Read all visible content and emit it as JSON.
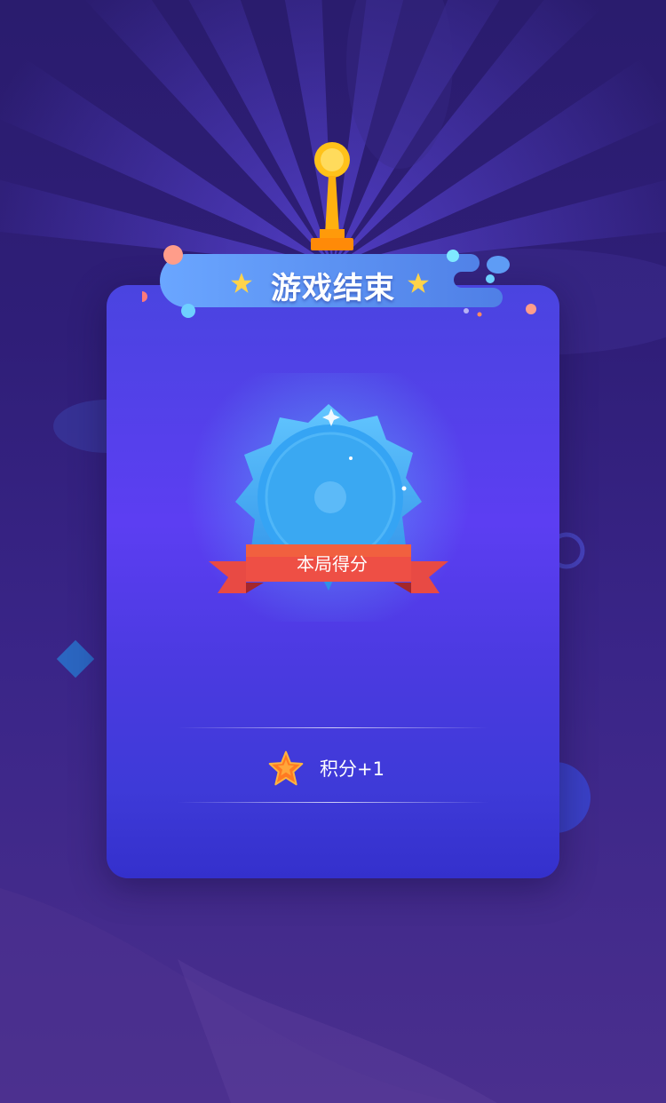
{
  "result": {
    "title": "游戏结束",
    "score_label": "本局得分",
    "reward_text": "积分+1"
  },
  "icons": {
    "trophy": "trophy-icon",
    "title_star": "star-icon",
    "medal": "crystal-medal-icon",
    "reward": "orange-star-icon"
  },
  "colors": {
    "background": "#2f1e78",
    "card_top": "#4a44e0",
    "card_mid": "#5c3ef2",
    "card_bottom": "#3430cc",
    "banner": "#4f86ea",
    "medal": "#3aa8f2",
    "ribbon": "#e84a44",
    "title_star": "#ffd34a",
    "trophy": "#ffc21a"
  }
}
